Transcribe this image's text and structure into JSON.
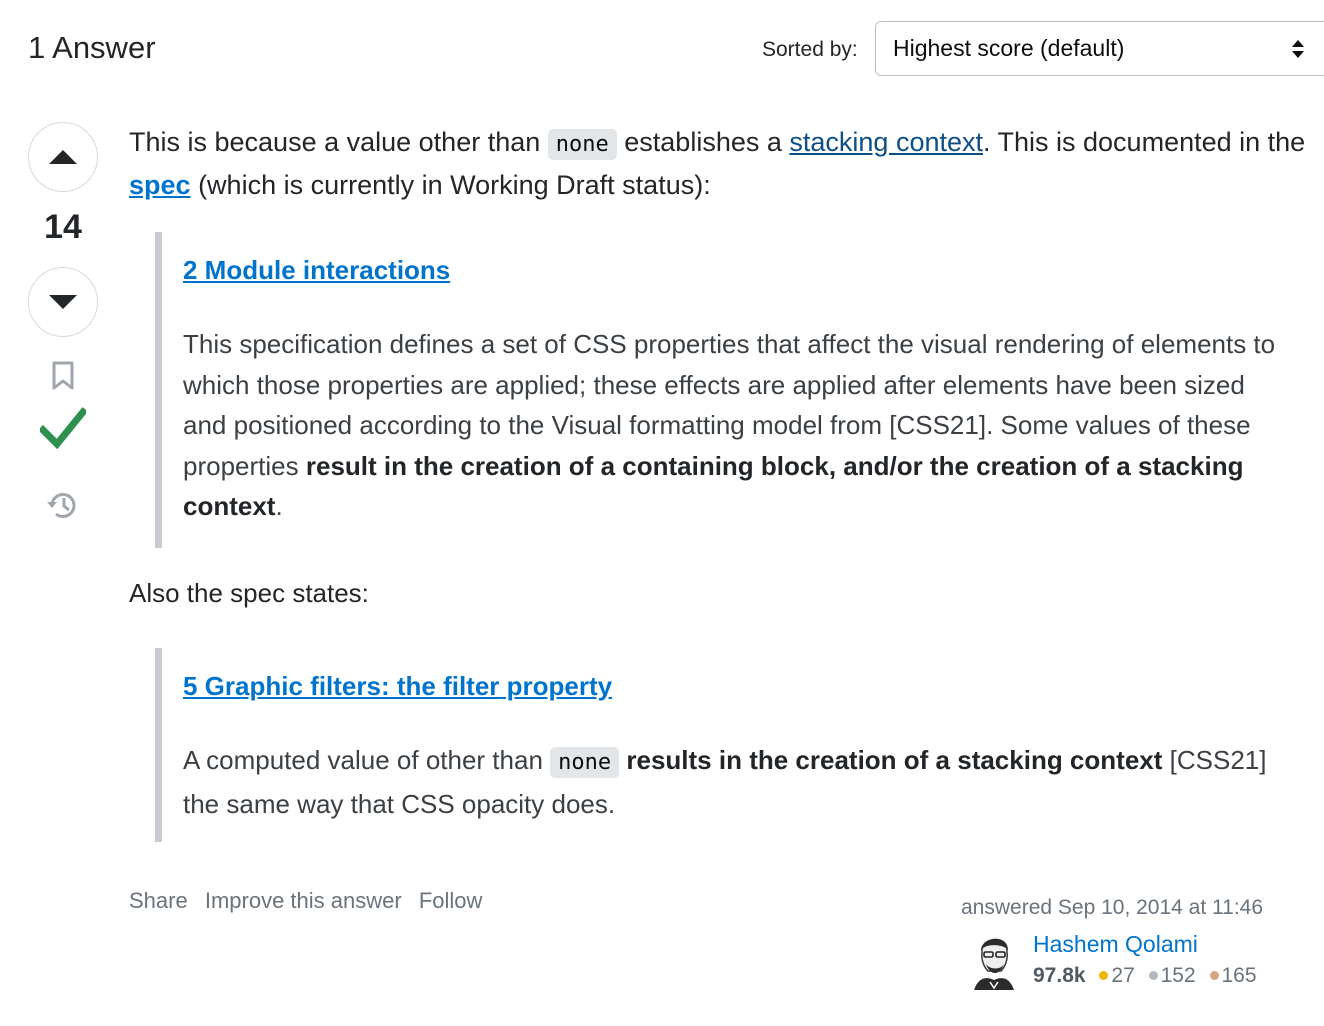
{
  "header": {
    "title": "1 Answer"
  },
  "sort": {
    "label": "Sorted by:",
    "selected": "Highest score (default)"
  },
  "votes": {
    "count": "14"
  },
  "answer": {
    "p1_a": "This is because a value other than",
    "code_none": "none",
    "p1_b": "establishes a",
    "link_stacking": "stacking context",
    "p1_c": ". This is documented in the",
    "link_spec": "spec",
    "p1_d": "(which is currently in Working Draft status):",
    "quote1": {
      "title": "2 Module interactions",
      "text_a": "This specification defines a set of CSS properties that affect the visual rendering of elements to which those properties are applied; these effects are applied after elements have been sized and positioned according to the Visual formatting model from [CSS21]. Some values of these properties",
      "text_bold": "result in the creation of a containing block, and/or the creation of a stacking context",
      "text_end": "."
    },
    "also": "Also the spec states:",
    "quote2": {
      "title": "5 Graphic filters: the filter property",
      "text_a": "A computed value of other than",
      "code": "none",
      "text_bold": "results in the creation of a stacking context",
      "text_b": "[CSS21] the same way that CSS opacity does."
    }
  },
  "actions": {
    "share": "Share",
    "improve": "Improve this answer",
    "follow": "Follow"
  },
  "user_card": {
    "answered": "answered Sep 10, 2014 at 11:46",
    "name": "Hashem Qolami",
    "reputation": "97.8k",
    "gold": "27",
    "silver": "152",
    "bronze": "165",
    "gold_color": "#f1b600",
    "silver_color": "#9a9fa5",
    "bronze_color": "#ab825f"
  },
  "colors": {
    "link": "#0074cc",
    "accepted": "#2f6f44",
    "accent_check": "#24a148"
  }
}
